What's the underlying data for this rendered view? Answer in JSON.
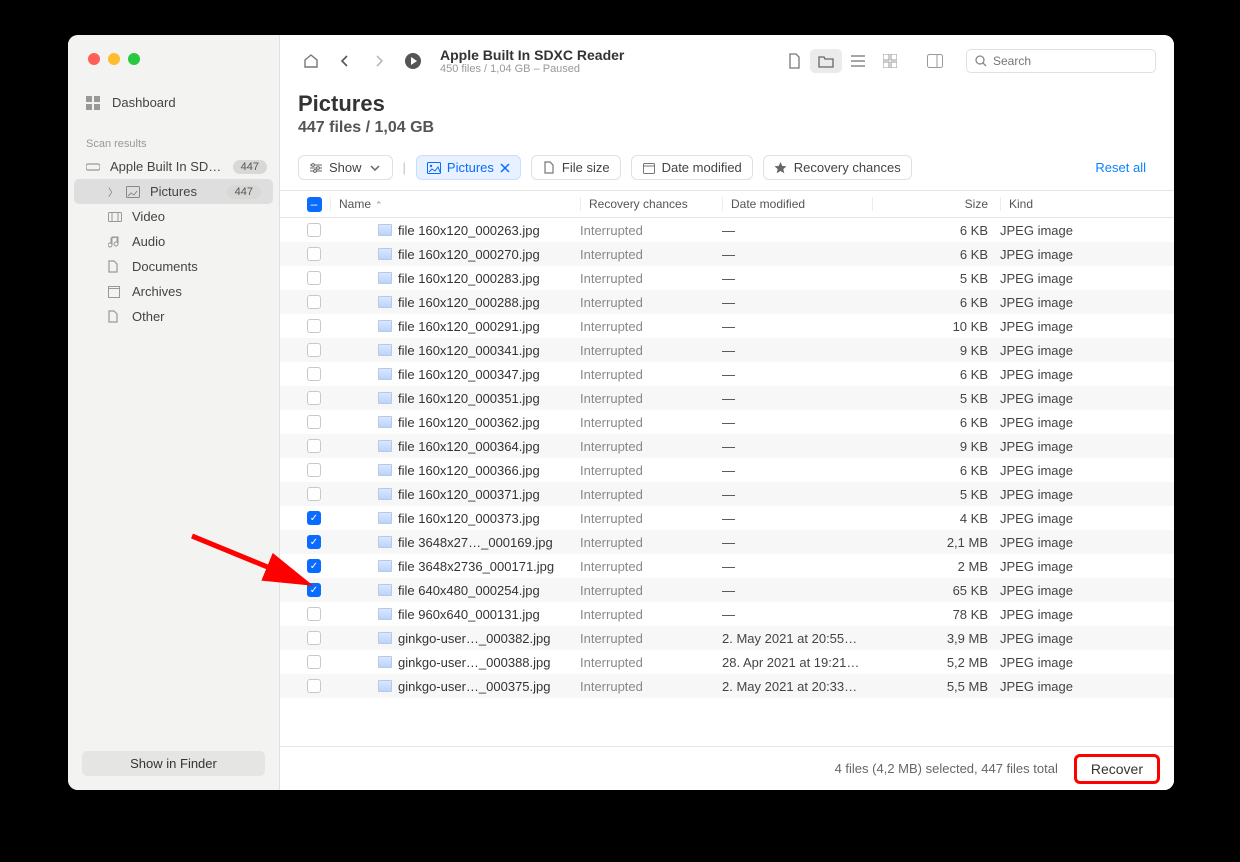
{
  "header": {
    "title": "Apple Built In SDXC Reader",
    "subtitle": "450 files / 1,04 GB – Paused",
    "search_placeholder": "Search"
  },
  "sidebar": {
    "dashboard": "Dashboard",
    "section_label": "Scan results",
    "device": {
      "label": "Apple Built In SD…",
      "badge": "447"
    },
    "items": [
      {
        "label": "Pictures",
        "badge": "447",
        "active": true
      },
      {
        "label": "Video"
      },
      {
        "label": "Audio"
      },
      {
        "label": "Documents"
      },
      {
        "label": "Archives"
      },
      {
        "label": "Other"
      }
    ],
    "show_in_finder": "Show in Finder"
  },
  "page": {
    "title": "Pictures",
    "subtitle": "447 files / 1,04 GB"
  },
  "filters": {
    "show": "Show",
    "pictures": "Pictures",
    "file_size": "File size",
    "date_modified": "Date modified",
    "recovery_chances": "Recovery chances",
    "reset": "Reset all"
  },
  "columns": {
    "name": "Name",
    "recovery": "Recovery chances",
    "date": "Date modified",
    "size": "Size",
    "kind": "Kind"
  },
  "rows": [
    {
      "checked": false,
      "name": "file 160x120_000263.jpg",
      "recovery": "Interrupted",
      "date": "—",
      "size": "6 KB",
      "kind": "JPEG image"
    },
    {
      "checked": false,
      "name": "file 160x120_000270.jpg",
      "recovery": "Interrupted",
      "date": "—",
      "size": "6 KB",
      "kind": "JPEG image"
    },
    {
      "checked": false,
      "name": "file 160x120_000283.jpg",
      "recovery": "Interrupted",
      "date": "—",
      "size": "5 KB",
      "kind": "JPEG image"
    },
    {
      "checked": false,
      "name": "file 160x120_000288.jpg",
      "recovery": "Interrupted",
      "date": "—",
      "size": "6 KB",
      "kind": "JPEG image"
    },
    {
      "checked": false,
      "name": "file 160x120_000291.jpg",
      "recovery": "Interrupted",
      "date": "—",
      "size": "10 KB",
      "kind": "JPEG image"
    },
    {
      "checked": false,
      "name": "file 160x120_000341.jpg",
      "recovery": "Interrupted",
      "date": "—",
      "size": "9 KB",
      "kind": "JPEG image"
    },
    {
      "checked": false,
      "name": "file 160x120_000347.jpg",
      "recovery": "Interrupted",
      "date": "—",
      "size": "6 KB",
      "kind": "JPEG image"
    },
    {
      "checked": false,
      "name": "file 160x120_000351.jpg",
      "recovery": "Interrupted",
      "date": "—",
      "size": "5 KB",
      "kind": "JPEG image"
    },
    {
      "checked": false,
      "name": "file 160x120_000362.jpg",
      "recovery": "Interrupted",
      "date": "—",
      "size": "6 KB",
      "kind": "JPEG image"
    },
    {
      "checked": false,
      "name": "file 160x120_000364.jpg",
      "recovery": "Interrupted",
      "date": "—",
      "size": "9 KB",
      "kind": "JPEG image"
    },
    {
      "checked": false,
      "name": "file 160x120_000366.jpg",
      "recovery": "Interrupted",
      "date": "—",
      "size": "6 KB",
      "kind": "JPEG image"
    },
    {
      "checked": false,
      "name": "file 160x120_000371.jpg",
      "recovery": "Interrupted",
      "date": "—",
      "size": "5 KB",
      "kind": "JPEG image"
    },
    {
      "checked": true,
      "name": "file 160x120_000373.jpg",
      "recovery": "Interrupted",
      "date": "—",
      "size": "4 KB",
      "kind": "JPEG image"
    },
    {
      "checked": true,
      "name": "file 3648x27…_000169.jpg",
      "recovery": "Interrupted",
      "date": "—",
      "size": "2,1 MB",
      "kind": "JPEG image"
    },
    {
      "checked": true,
      "name": "file 3648x2736_000171.jpg",
      "recovery": "Interrupted",
      "date": "—",
      "size": "2 MB",
      "kind": "JPEG image"
    },
    {
      "checked": true,
      "name": "file 640x480_000254.jpg",
      "recovery": "Interrupted",
      "date": "—",
      "size": "65 KB",
      "kind": "JPEG image"
    },
    {
      "checked": false,
      "name": "file 960x640_000131.jpg",
      "recovery": "Interrupted",
      "date": "—",
      "size": "78 KB",
      "kind": "JPEG image"
    },
    {
      "checked": false,
      "name": "ginkgo-user…_000382.jpg",
      "recovery": "Interrupted",
      "date": "2. May 2021 at 20:55…",
      "size": "3,9 MB",
      "kind": "JPEG image"
    },
    {
      "checked": false,
      "name": "ginkgo-user…_000388.jpg",
      "recovery": "Interrupted",
      "date": "28. Apr 2021 at 19:21…",
      "size": "5,2 MB",
      "kind": "JPEG image"
    },
    {
      "checked": false,
      "name": "ginkgo-user…_000375.jpg",
      "recovery": "Interrupted",
      "date": "2. May 2021 at 20:33…",
      "size": "5,5 MB",
      "kind": "JPEG image"
    }
  ],
  "footer": {
    "status": "4 files (4,2 MB) selected, 447 files total",
    "recover": "Recover"
  }
}
